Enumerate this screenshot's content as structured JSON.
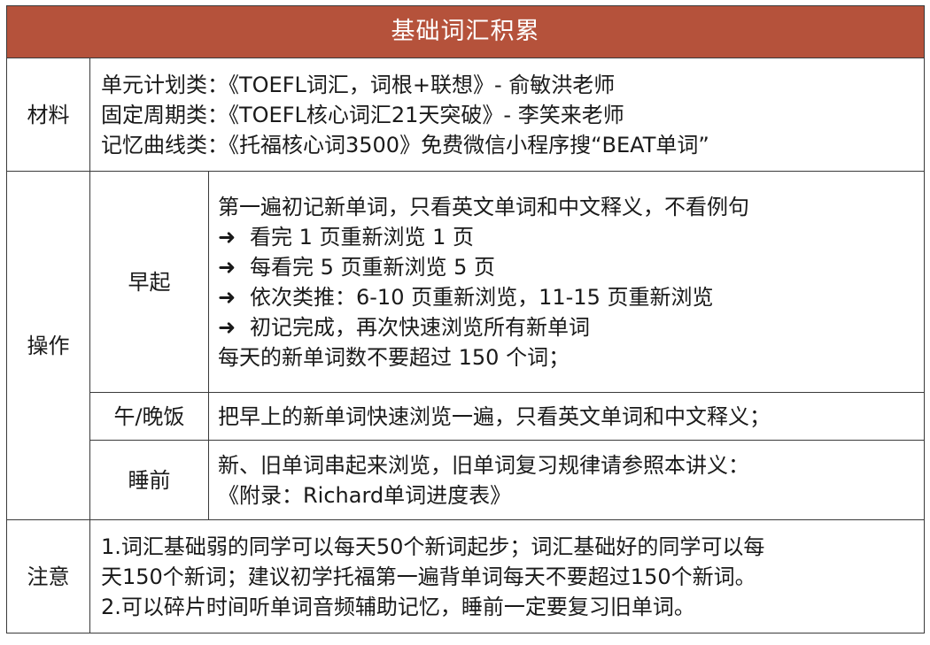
{
  "title": "基础词汇积累",
  "materials": {
    "label": "材料",
    "lines": [
      "单元计划类：《TOEFL词汇，词根+联想》- 俞敏洪老师",
      "固定周期类：《TOEFL核心词汇21天突破》- 李笑来老师",
      "记忆曲线类：《托福核心词3500》免费微信小程序搜“BEAT单词”"
    ]
  },
  "operations": {
    "label": "操作",
    "morning": {
      "label": "早起",
      "intro": "第一遍初记新单词，只看英文单词和中文释义，不看例句",
      "arrow_symbol": "➜",
      "steps": [
        "看完 1 页重新浏览 1 页",
        "每看完 5 页重新浏览 5 页",
        "依次类推：6-10 页重新浏览，11-15 页重新浏览",
        "初记完成，再次快速浏览所有新单词"
      ],
      "limit": "每天的新单词数不要超过 150 个词；"
    },
    "lunch": {
      "label": "午/晚饭",
      "text": "把早上的新单词快速浏览一遍，只看英文单词和中文释义；"
    },
    "bedtime": {
      "label": "睡前",
      "lines": [
        "新、旧单词串起来浏览，旧单词复习规律请参照本讲义：",
        "《附录：Richard单词进度表》"
      ]
    }
  },
  "notes": {
    "label": "注意",
    "lines": [
      "1.词汇基础弱的同学可以每天50个新词起步；词汇基础好的同学可以每",
      "天150个新词；建议初学托福第一遍背单词每天不要超过150个新词。",
      "2.可以碎片时间听单词音频辅助记忆，睡前一定要复习旧单词。"
    ]
  },
  "colors": {
    "header_bg": "#b5523b",
    "header_text": "#ffffff",
    "border": "#3a3a3a"
  }
}
